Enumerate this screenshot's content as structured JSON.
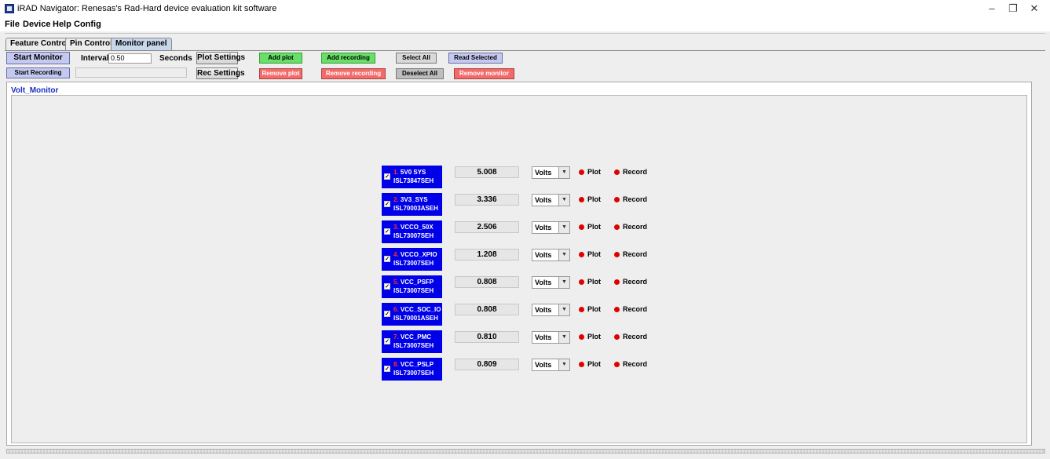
{
  "window": {
    "title": "iRAD Navigator: Renesas's Rad-Hard device evaluation kit software",
    "minimize_icon": "minimize-icon",
    "maximize_icon": "restore-icon",
    "close_icon": "close-icon"
  },
  "menu": [
    "File",
    "Device",
    "Help",
    "Config"
  ],
  "tabs": [
    {
      "label": "Feature Control",
      "active": false
    },
    {
      "label": "Pin Control",
      "active": false
    },
    {
      "label": "Monitor panel",
      "active": true
    }
  ],
  "toolbar": {
    "start_monitor": "Start Monitor",
    "interval_label": "Interval",
    "interval_value": "0.50",
    "seconds_label": "Seconds",
    "plot_settings": "Plot Settings",
    "start_recording": "Start Recording",
    "rec_settings": "Rec Settings",
    "add_plot": "Add plot",
    "remove_plot": "Remove plot",
    "add_recording": "Add recording",
    "remove_recording": "Remove recording",
    "select_all": "Select All",
    "deselect_all": "Deselect All",
    "read_selected": "Read Selected",
    "remove_monitor": "Remove monitor"
  },
  "panel": {
    "title": "Volt_Monitor"
  },
  "channels": [
    {
      "num": "1.",
      "name": "5V0 SYS",
      "device": "ISL73847SEH",
      "checked": true,
      "value": "5.008",
      "unit": "Volts",
      "plot": "Plot",
      "record": "Record"
    },
    {
      "num": "2.",
      "name": "3V3_SYS",
      "device": "ISL70003ASEH",
      "checked": true,
      "value": "3.336",
      "unit": "Volts",
      "plot": "Plot",
      "record": "Record"
    },
    {
      "num": "3.",
      "name": "VCCO_50X",
      "device": "ISL73007SEH",
      "checked": true,
      "value": "2.506",
      "unit": "Volts",
      "plot": "Plot",
      "record": "Record"
    },
    {
      "num": "4.",
      "name": "VCCO_XPIO",
      "device": "ISL73007SEH",
      "checked": true,
      "value": "1.208",
      "unit": "Volts",
      "plot": "Plot",
      "record": "Record"
    },
    {
      "num": "5.",
      "name": "VCC_PSFP",
      "device": "ISL73007SEH",
      "checked": true,
      "value": "0.808",
      "unit": "Volts",
      "plot": "Plot",
      "record": "Record"
    },
    {
      "num": "6.",
      "name": "VCC_SOC_IO",
      "device": "ISL70001ASEH",
      "checked": true,
      "value": "0.808",
      "unit": "Volts",
      "plot": "Plot",
      "record": "Record"
    },
    {
      "num": "7.",
      "name": "VCC_PMC",
      "device": "ISL73007SEH",
      "checked": true,
      "value": "0.810",
      "unit": "Volts",
      "plot": "Plot",
      "record": "Record"
    },
    {
      "num": "8.",
      "name": "VCC_PSLP",
      "device": "ISL73007SEH",
      "checked": true,
      "value": "0.809",
      "unit": "Volts",
      "plot": "Plot",
      "record": "Record"
    }
  ],
  "colors": {
    "channel_label_bg": "#0000e8",
    "channel_number": "#ff3030",
    "status_dot": "#e00000",
    "add_button": "#66e066",
    "remove_button": "#f36a6a",
    "primary_button": "#c5c9f0",
    "panel_title": "#1b2fbf"
  }
}
